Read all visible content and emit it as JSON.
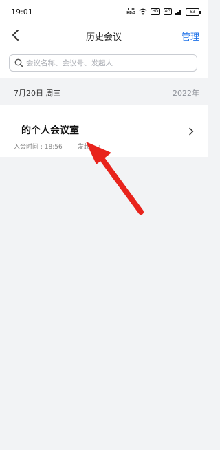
{
  "status_bar": {
    "time": "19:01",
    "net_speed_value": "1.00",
    "net_speed_unit": "KB/S",
    "hd_badge": "HD",
    "signal_label": "4G",
    "battery": "63"
  },
  "header": {
    "title": "历史会议",
    "manage_label": "管理"
  },
  "search": {
    "placeholder": "会议名称、会议号、发起人"
  },
  "date_group": {
    "date_label": "7月20日 周三",
    "year_label": "2022年"
  },
  "meetings": [
    {
      "title": "的个人会议室",
      "join_time": "入会时间 : 18:56",
      "host": "发起人 :"
    }
  ],
  "colors": {
    "accent": "#1f72e8",
    "annotation_arrow": "#e8231c"
  }
}
